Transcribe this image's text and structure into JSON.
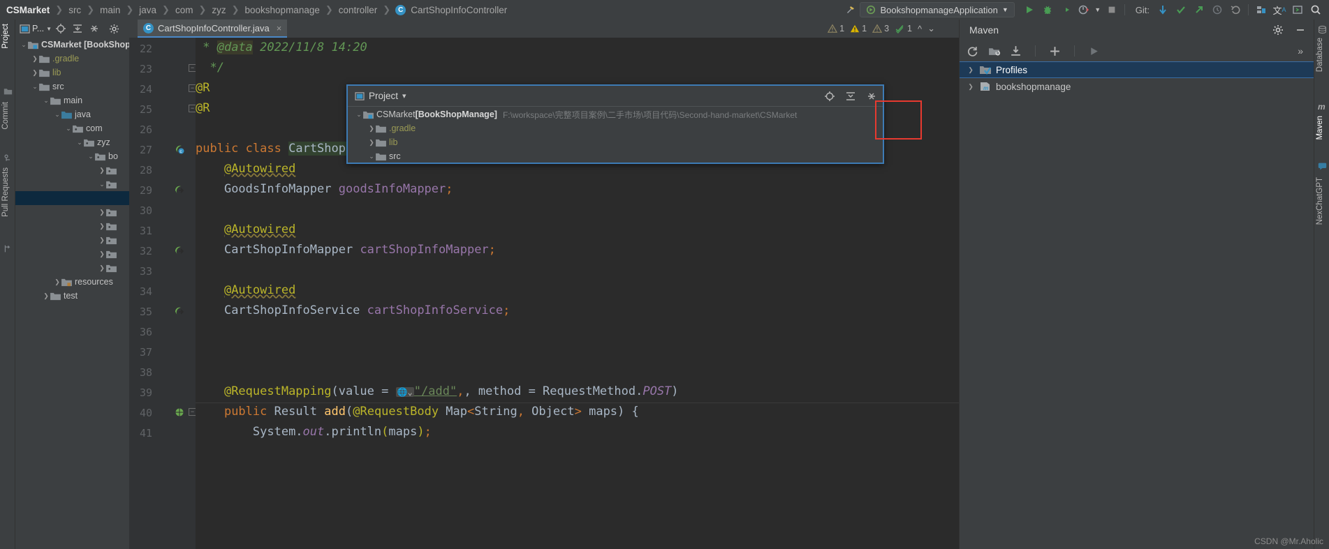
{
  "breadcrumb": {
    "items": [
      "CSMarket",
      "src",
      "main",
      "java",
      "com",
      "zyz",
      "bookshopmanage",
      "controller"
    ],
    "current_class": "CartShopInfoController",
    "class_icon": "C"
  },
  "toolbar": {
    "run_config": "BookshopmanageApplication",
    "git_label": "Git:",
    "icons": [
      "hammer-icon",
      "run-icon",
      "debug-icon",
      "run-with-coverage-icon",
      "profiler-icon",
      "stop-icon",
      "update-project-icon",
      "commit-icon",
      "push-icon",
      "history-icon",
      "rollback-icon",
      "structure-icon",
      "translate-icon",
      "terminal-icon",
      "search-icon"
    ]
  },
  "left_strip": {
    "labels": [
      "Project",
      "Commit",
      "Pull Requests"
    ]
  },
  "project_panel": {
    "toolbar_label": "P...",
    "tree": [
      {
        "indent": 0,
        "arrow": "v",
        "icon": "module-folder",
        "label": "CSMarket [BookShop",
        "bold": true
      },
      {
        "indent": 1,
        "arrow": ">",
        "icon": "folder",
        "label": ".gradle",
        "yellow": true
      },
      {
        "indent": 1,
        "arrow": ">",
        "icon": "folder",
        "label": "lib",
        "yellow": true
      },
      {
        "indent": 1,
        "arrow": "v",
        "icon": "folder",
        "label": "src"
      },
      {
        "indent": 2,
        "arrow": "v",
        "icon": "folder",
        "label": "main"
      },
      {
        "indent": 3,
        "arrow": "v",
        "icon": "source-folder",
        "label": "java"
      },
      {
        "indent": 4,
        "arrow": "v",
        "icon": "package",
        "label": "com"
      },
      {
        "indent": 5,
        "arrow": "v",
        "icon": "package",
        "label": "zyz"
      },
      {
        "indent": 6,
        "arrow": "v",
        "icon": "package",
        "label": "bo"
      },
      {
        "indent": 7,
        "arrow": ">",
        "icon": "package",
        "label": ""
      },
      {
        "indent": 7,
        "arrow": "v",
        "icon": "package",
        "label": ""
      },
      {
        "indent": 7,
        "arrow": "",
        "icon": "",
        "label": "",
        "selected": true
      },
      {
        "indent": 7,
        "arrow": ">",
        "icon": "package",
        "label": ""
      },
      {
        "indent": 7,
        "arrow": ">",
        "icon": "package",
        "label": ""
      },
      {
        "indent": 7,
        "arrow": ">",
        "icon": "package",
        "label": ""
      },
      {
        "indent": 7,
        "arrow": ">",
        "icon": "package",
        "label": ""
      },
      {
        "indent": 7,
        "arrow": ">",
        "icon": "package",
        "label": ""
      },
      {
        "indent": 3,
        "arrow": ">",
        "icon": "resource-folder",
        "label": "resources"
      },
      {
        "indent": 2,
        "arrow": ">",
        "icon": "folder",
        "label": "test"
      }
    ]
  },
  "editor": {
    "tab": {
      "label": "CartShopInfoController.java",
      "icon": "java-class-icon",
      "close": "×"
    },
    "inspections": {
      "grey_warnings": "1",
      "yellow_warnings": "1",
      "weak_warnings": "3",
      "typos": "1"
    },
    "lines": [
      {
        "num": "22",
        "gutter": "",
        "fold": "",
        "text": "  * @data 2022/11/8 14:20",
        "kind": "comment"
      },
      {
        "num": "23",
        "gutter": "",
        "fold": "collapse",
        "text": "  */",
        "kind": "comment"
      },
      {
        "num": "24",
        "gutter": "",
        "fold": "collapse",
        "text": "@R",
        "kind": "annotation"
      },
      {
        "num": "25",
        "gutter": "",
        "fold": "collapse",
        "text": "@R",
        "kind": "annotation"
      },
      {
        "num": "26",
        "gutter": "",
        "fold": "",
        "text": "",
        "kind": "blank"
      },
      {
        "num": "27",
        "gutter": "class-bean-icon",
        "fold": "",
        "text": "public class CartShopInfoController {",
        "kind": "classdecl"
      },
      {
        "num": "28",
        "gutter": "",
        "fold": "",
        "text": "    @Autowired",
        "kind": "autowired"
      },
      {
        "num": "29",
        "gutter": "bean-arrow-icon",
        "fold": "",
        "text": "    GoodsInfoMapper goodsInfoMapper;",
        "kind": "field",
        "type": "GoodsInfoMapper",
        "name": "goodsInfoMapper"
      },
      {
        "num": "30",
        "gutter": "",
        "fold": "",
        "text": "",
        "kind": "blank"
      },
      {
        "num": "31",
        "gutter": "",
        "fold": "",
        "text": "    @Autowired",
        "kind": "autowired"
      },
      {
        "num": "32",
        "gutter": "bean-arrow-icon",
        "fold": "",
        "text": "    CartShopInfoMapper cartShopInfoMapper;",
        "kind": "field",
        "type": "CartShopInfoMapper",
        "name": "cartShopInfoMapper"
      },
      {
        "num": "33",
        "gutter": "",
        "fold": "",
        "text": "",
        "kind": "blank"
      },
      {
        "num": "34",
        "gutter": "",
        "fold": "",
        "text": "    @Autowired",
        "kind": "autowired"
      },
      {
        "num": "35",
        "gutter": "bean-arrow-icon",
        "fold": "",
        "text": "    CartShopInfoService cartShopInfoService;",
        "kind": "field",
        "type": "CartShopInfoService",
        "name": "cartShopInfoService"
      },
      {
        "num": "36",
        "gutter": "",
        "fold": "",
        "text": "",
        "kind": "blank"
      },
      {
        "num": "37",
        "gutter": "",
        "fold": "",
        "text": "",
        "kind": "blank"
      },
      {
        "num": "38",
        "gutter": "",
        "fold": "",
        "text": "",
        "kind": "blank"
      },
      {
        "num": "39",
        "gutter": "",
        "fold": "",
        "text": "    @RequestMapping(value = \"/add\", method = RequestMethod.POST)",
        "kind": "requestmapping"
      },
      {
        "num": "40",
        "gutter": "web-method-icon",
        "fold": "collapse",
        "text": "    public Result add(@RequestBody Map<String, Object> maps) {",
        "kind": "methoddecl"
      },
      {
        "num": "41",
        "gutter": "",
        "fold": "",
        "text": "        System.out.println(maps);",
        "kind": "println"
      }
    ],
    "annotation_text_39": {
      "ann": "@RequestMapping",
      "p1": "(value = ",
      "url": "\"/add\"",
      "p2": ", method = ",
      "rm": "RequestMethod.",
      "post": "POST",
      "p3": ")"
    },
    "method_text_40": {
      "kw1": "public ",
      "ret": "Result ",
      "name": "add",
      "p1": "(",
      "ann": "@RequestBody ",
      "typ": "Map<String, Object> ",
      "param": "maps",
      "p2": ") {"
    },
    "println_41": {
      "sys": "System.",
      "out": "out",
      ".p": ".println",
      "p1": "(",
      "arg": "maps",
      "p2": ");"
    }
  },
  "popup": {
    "title": "Project",
    "title_icon": "project-view-icon",
    "dropdown_caret": "▾",
    "actions": [
      "target-icon",
      "collapse-all-icon",
      "expand-settings-icon"
    ],
    "tree": [
      {
        "indent": 0,
        "arrow": "v",
        "icon": "module-folder",
        "name": "CSMarket ",
        "name_bold": "[BookShopManage]",
        "path": "F:\\workspace\\完整项目案例\\二手市场\\项目代码\\Second-hand-market\\CSMarket"
      },
      {
        "indent": 1,
        "arrow": ">",
        "icon": "folder",
        "name": ".gradle",
        "yellow": true,
        "path": ""
      },
      {
        "indent": 1,
        "arrow": ">",
        "icon": "folder",
        "name": "lib",
        "yellow": true,
        "path": ""
      },
      {
        "indent": 1,
        "arrow": "v",
        "icon": "folder",
        "name": "src",
        "path": ""
      }
    ],
    "highlight_box_color": "#e83a30"
  },
  "maven": {
    "title": "Maven",
    "head_actions": [
      "gear-icon",
      "minimize-icon"
    ],
    "toolbar_icons": [
      "reload-icon",
      "add-maven-project-icon",
      "download-sources-icon",
      "add-icon",
      "run-icon",
      "more-icon"
    ],
    "tree": [
      {
        "arrow": ">",
        "icon": "profiles-icon",
        "label": "Profiles",
        "selected": true
      },
      {
        "arrow": ">",
        "icon": "maven-module-icon",
        "label": "bookshopmanage",
        "selected": false
      }
    ]
  },
  "right_strip": {
    "labels": [
      "Database",
      "Maven",
      "NexChatGPT"
    ]
  },
  "watermark": "CSDN @Mr.Aholic",
  "colors": {
    "accent_blue": "#4a88c7",
    "selection_blue": "#1d3a57",
    "editor_bg": "#2b2b2b",
    "panel_bg": "#3c3f41",
    "gutter_bg": "#313335",
    "keyword": "#cc7832",
    "string": "#6a8759",
    "annotation": "#bbb529",
    "field": "#9876aa",
    "comment": "#629755",
    "red_box": "#e83a30"
  }
}
